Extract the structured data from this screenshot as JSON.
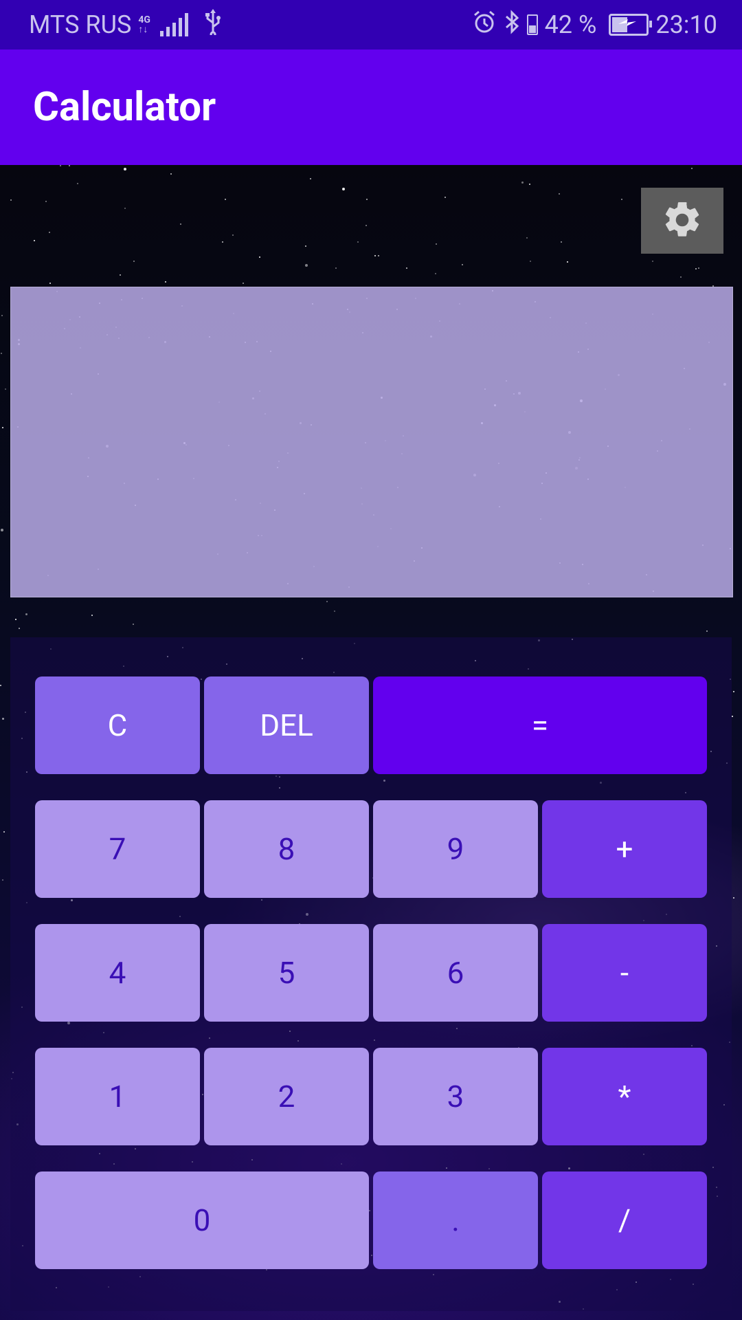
{
  "status_bar": {
    "carrier": "MTS RUS",
    "network_top": "4G",
    "network_bottom": "↑↓",
    "battery_percent": "42 %",
    "time": "23:10"
  },
  "app_bar": {
    "title": "Calculator"
  },
  "display": {
    "value": ""
  },
  "keypad": {
    "clear": "C",
    "delete": "DEL",
    "equals": "=",
    "seven": "7",
    "eight": "8",
    "nine": "9",
    "plus": "+",
    "four": "4",
    "five": "5",
    "six": "6",
    "minus": "-",
    "one": "1",
    "two": "2",
    "three": "3",
    "multiply": "*",
    "zero": "0",
    "dot": ".",
    "divide": "/"
  },
  "colors": {
    "status_bar": "#3200b3",
    "app_bar": "#6200ee",
    "digit_key": "#ad95ec",
    "function_key": "#8565ea",
    "operator_key": "#7236e8",
    "equals_key": "#6200ee"
  },
  "icons": {
    "settings": "gear-icon"
  }
}
